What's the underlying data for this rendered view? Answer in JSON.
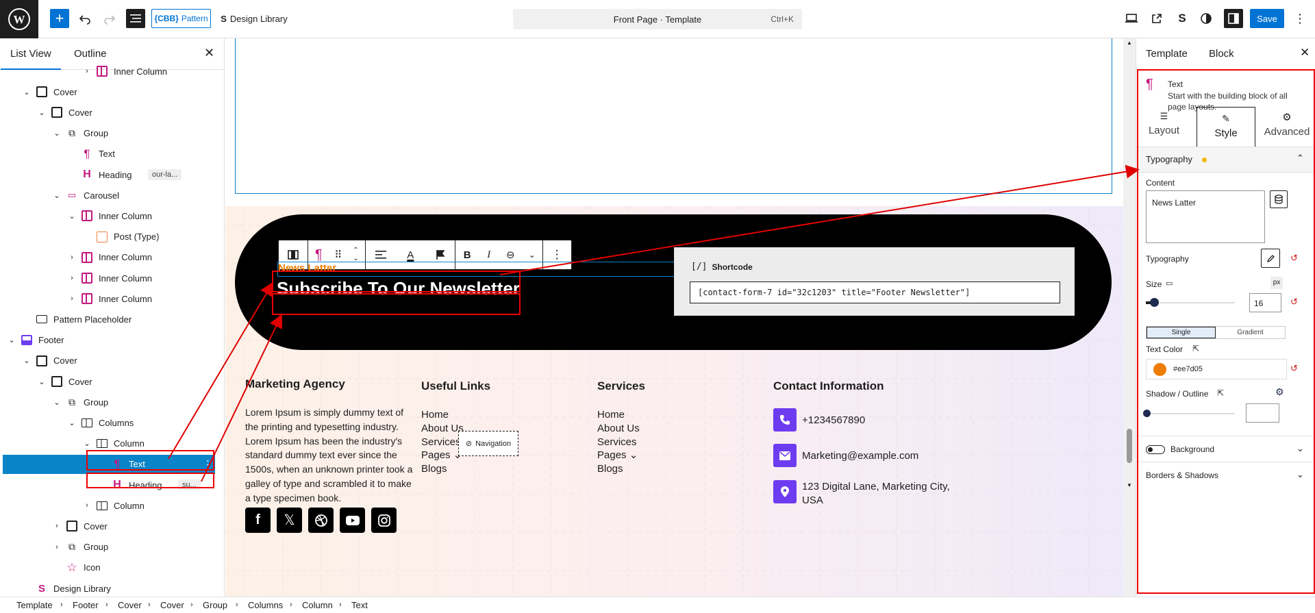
{
  "topbar": {
    "pattern_label": "Pattern",
    "pattern_prefix": "{CBB}",
    "design_library_label": "Design Library",
    "doc_title": "Front Page · Template",
    "doc_shortcut": "Ctrl+K",
    "save_label": "Save"
  },
  "left_panel": {
    "tabs": [
      "List View",
      "Outline"
    ],
    "tree": [
      {
        "label": "Inner Column",
        "depth": 5
      },
      {
        "label": "Cover",
        "depth": 1
      },
      {
        "label": "Cover",
        "depth": 2
      },
      {
        "label": "Group",
        "depth": 3
      },
      {
        "label": "Text",
        "depth": 4
      },
      {
        "label": "Heading",
        "depth": 4,
        "badge": "our-la..."
      },
      {
        "label": "Carousel",
        "depth": 3
      },
      {
        "label": "Inner Column",
        "depth": 4
      },
      {
        "label": "Post (Type)",
        "depth": 5
      },
      {
        "label": "Inner Column",
        "depth": 4
      },
      {
        "label": "Inner Column",
        "depth": 4
      },
      {
        "label": "Inner Column",
        "depth": 4
      },
      {
        "label": "Pattern Placeholder",
        "depth": 1
      },
      {
        "label": "Footer",
        "depth": 0
      },
      {
        "label": "Cover",
        "depth": 1
      },
      {
        "label": "Cover",
        "depth": 2
      },
      {
        "label": "Group",
        "depth": 3
      },
      {
        "label": "Columns",
        "depth": 4
      },
      {
        "label": "Column",
        "depth": 5
      },
      {
        "label": "Text",
        "depth": 6
      },
      {
        "label": "Heading",
        "depth": 6,
        "badge": "su..."
      },
      {
        "label": "Column",
        "depth": 5
      },
      {
        "label": "Cover",
        "depth": 3
      },
      {
        "label": "Group",
        "depth": 3
      },
      {
        "label": "Icon",
        "depth": 3
      },
      {
        "label": "Design Library",
        "depth": 1
      }
    ]
  },
  "canvas": {
    "newsletter_small": "News Latter",
    "newsletter_heading": "Subscribe To Our Newsletter",
    "shortcode_label": "Shortcode",
    "shortcode_value": "[contact-form-7 id=\"32c1203\" title=\"Footer Newsletter\"]",
    "footer": {
      "col1_title": "Marketing Agency",
      "col1_text": "Lorem Ipsum is simply dummy text of the printing and typesetting industry. Lorem Ipsum has been the industry's standard dummy text ever since the 1500s, when an unknown printer took a galley of type and scrambled it to make a type specimen book.",
      "col2_title": "Useful Links",
      "col2_links": [
        "Home",
        "About Us",
        "Services",
        "Pages",
        "Blogs"
      ],
      "nav_tooltip": "Navigation",
      "col3_title": "Services",
      "col3_links": [
        "Home",
        "About Us",
        "Services",
        "Pages",
        "Blogs"
      ],
      "col4_title": "Contact Information",
      "phone": "+1234567890",
      "email": "Marketing@example.com",
      "address": "123 Digital Lane, Marketing City, USA"
    }
  },
  "right_panel": {
    "tabs": [
      "Template",
      "Block"
    ],
    "block_name": "Text",
    "block_desc": "Start with the building block of all page layouts.",
    "subtabs": [
      "Layout",
      "Style",
      "Advanced"
    ],
    "typography_section": "Typography",
    "content_label": "Content",
    "content_value": "News Latter",
    "typography_label": "Typography",
    "size_label": "Size",
    "size_unit": "px",
    "size_value": "16",
    "fill_modes": [
      "Single",
      "Gradient"
    ],
    "text_color_label": "Text Color",
    "text_color_value": "#ee7d05",
    "shadow_label": "Shadow / Outline",
    "background_label": "Background",
    "borders_label": "Borders & Shadows"
  },
  "breadcrumb": [
    "Template",
    "Footer",
    "Cover",
    "Cover",
    "Group",
    "Columns",
    "Column",
    "Text"
  ],
  "colors": {
    "accent": "#0073d4",
    "text_orange": "#ee7d05",
    "purple": "#6d3cf0",
    "annotation_red": "#e00000"
  }
}
